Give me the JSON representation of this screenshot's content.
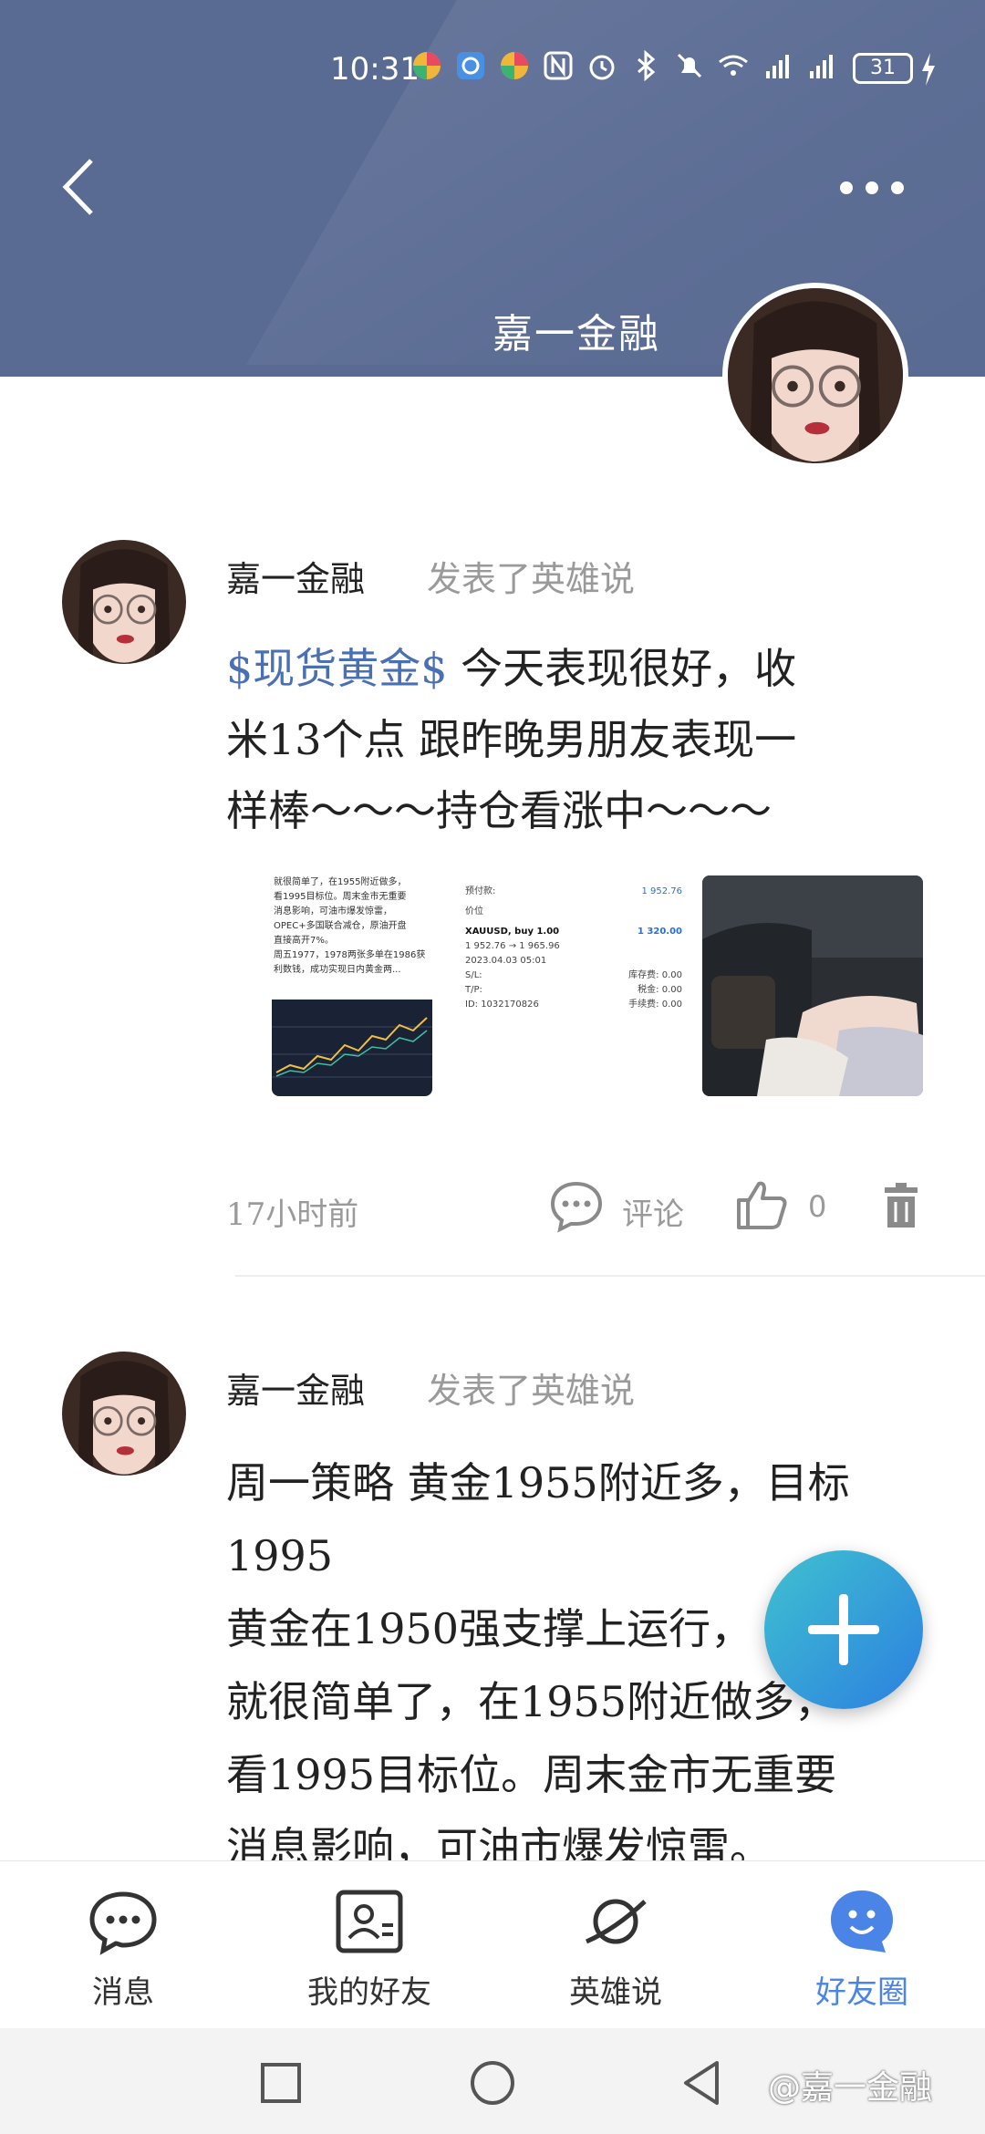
{
  "status_bar": {
    "time": "10:31",
    "battery": "31"
  },
  "header": {
    "title": "嘉一金融"
  },
  "posts": [
    {
      "author": "嘉一金融",
      "action": "发表了英雄说",
      "tag": "$现货黄金$",
      "text_line1": " 今天表现很好，收",
      "text_line2": "米13个点 跟昨晚男朋友表现一",
      "text_line3": "样棒～～～持仓看涨中～～～",
      "time": "17小时前",
      "comment_label": "评论",
      "like_count": "0",
      "images": {
        "img1_lines": [
          "就很简单了，在1955附近做多，",
          "看1995目标位。周末金市无重要",
          "消息影响，可油市爆发惊雷，",
          "OPEC+多国联合减仓，原油开盘",
          "直接高开7%。",
          "周五1977，1978两张多单在1986获",
          "利数钱，成功实现日内黄金两..."
        ],
        "img2_rows": [
          {
            "label": "预付款:",
            "value": "1 952.76"
          },
          {
            "label": "价位",
            "value": ""
          },
          {
            "label": "XAUUSD, buy 1.00",
            "value": "1 320.00"
          },
          {
            "label": "1 952.76 → 1 965.96",
            "value": ""
          },
          {
            "label": "2023.04.03 05:01",
            "value": ""
          },
          {
            "label": "S/L:",
            "value": "库存费: 0.00"
          },
          {
            "label": "T/P:",
            "value": "税金: 0.00"
          },
          {
            "label": "ID: 1032170826",
            "value": "手续费: 0.00"
          }
        ]
      }
    },
    {
      "author": "嘉一金融",
      "action": "发表了英雄说",
      "lines": [
        "周一策略 黄金1955附近多，目标",
        "1995",
        "黄金在1950强支撑上运行，",
        "就很简单了，在1955附近做多，",
        "看1995目标位。周末金市无重要",
        "消息影响，可油市爆发惊雷。"
      ]
    }
  ],
  "bottom_nav": [
    {
      "label": "消息",
      "icon": "chat-bubble-icon",
      "active": false
    },
    {
      "label": "我的好友",
      "icon": "contact-card-icon",
      "active": false
    },
    {
      "label": "英雄说",
      "icon": "planet-icon",
      "active": false
    },
    {
      "label": "好友圈",
      "icon": "smiley-bubble-icon",
      "active": true
    }
  ],
  "watermark": "@嘉一金融",
  "colors": {
    "header": "#5a6b93",
    "tag": "#4b6fb3",
    "active_nav": "#4a84e6",
    "fab_start": "#3fc2d0",
    "fab_end": "#2c7fe0"
  }
}
